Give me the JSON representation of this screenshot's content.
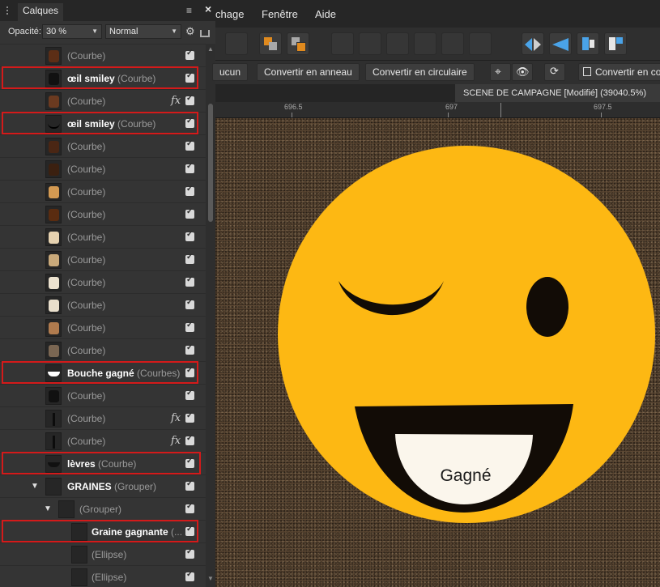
{
  "menu": {
    "items": [
      "chage",
      "Fenêtre",
      "Aide"
    ]
  },
  "layers_panel": {
    "tab_label": "Calques",
    "opacity_label": "Opacité:",
    "opacity_value": "30 %",
    "blend_mode": "Normal",
    "rows": [
      {
        "name": "",
        "type": "(Courbe)",
        "fx": false,
        "highlight": false,
        "indent": 0
      },
      {
        "name": "œil smiley",
        "type": "(Courbe)",
        "fx": false,
        "highlight": true,
        "indent": 0
      },
      {
        "name": "",
        "type": "(Courbe)",
        "fx": true,
        "highlight": false,
        "indent": 0
      },
      {
        "name": "œil smiley",
        "type": "(Courbe)",
        "fx": false,
        "highlight": true,
        "indent": 0
      },
      {
        "name": "",
        "type": "(Courbe)",
        "fx": false,
        "highlight": false,
        "indent": 0
      },
      {
        "name": "",
        "type": "(Courbe)",
        "fx": false,
        "highlight": false,
        "indent": 0
      },
      {
        "name": "",
        "type": "(Courbe)",
        "fx": false,
        "highlight": false,
        "indent": 0
      },
      {
        "name": "",
        "type": "(Courbe)",
        "fx": false,
        "highlight": false,
        "indent": 0
      },
      {
        "name": "",
        "type": "(Courbe)",
        "fx": false,
        "highlight": false,
        "indent": 0
      },
      {
        "name": "",
        "type": "(Courbe)",
        "fx": false,
        "highlight": false,
        "indent": 0
      },
      {
        "name": "",
        "type": "(Courbe)",
        "fx": false,
        "highlight": false,
        "indent": 0
      },
      {
        "name": "",
        "type": "(Courbe)",
        "fx": false,
        "highlight": false,
        "indent": 0
      },
      {
        "name": "",
        "type": "(Courbe)",
        "fx": false,
        "highlight": false,
        "indent": 0
      },
      {
        "name": "",
        "type": "(Courbe)",
        "fx": false,
        "highlight": false,
        "indent": 0
      },
      {
        "name": "Bouche gagné",
        "type": "(Courbes)",
        "fx": false,
        "highlight": true,
        "indent": 0
      },
      {
        "name": "",
        "type": "(Courbe)",
        "fx": false,
        "highlight": false,
        "indent": 0
      },
      {
        "name": "",
        "type": "(Courbe)",
        "fx": true,
        "highlight": false,
        "indent": 0
      },
      {
        "name": "",
        "type": "(Courbe)",
        "fx": true,
        "highlight": false,
        "indent": 0
      },
      {
        "name": "lèvres",
        "type": "(Courbe)",
        "fx": false,
        "highlight": true,
        "indent": 0
      },
      {
        "name": "GRAINES",
        "type": "(Grouper)",
        "fx": false,
        "highlight": false,
        "indent": 0,
        "group": true
      },
      {
        "name": "",
        "type": "(Grouper)",
        "fx": false,
        "highlight": false,
        "indent": 1,
        "group": true
      },
      {
        "name": "Graine gagnante",
        "type": "(...",
        "fx": false,
        "highlight": true,
        "indent": 2
      },
      {
        "name": "",
        "type": "(Ellipse)",
        "fx": false,
        "highlight": false,
        "indent": 2
      },
      {
        "name": "",
        "type": "(Ellipse)",
        "fx": false,
        "highlight": false,
        "indent": 2
      }
    ]
  },
  "context_toolbar": {
    "btn_none": "ucun",
    "btn_ring": "Convertir en anneau",
    "btn_circular": "Convertir en circulaire",
    "btn_convert": "Convertir en co"
  },
  "document": {
    "tab_title": "SCENE DE CAMPAGNE [Modifié] (39040.5%)",
    "close_symbol": "×"
  },
  "ruler": {
    "labels": [
      "696.5",
      "697",
      "697.5"
    ]
  },
  "canvas": {
    "smiley_text": "Gagné"
  },
  "colors": {
    "smiley_yellow": "#FDB813",
    "highlight_red": "#D41A1A",
    "background_brown": "#5A4632"
  }
}
